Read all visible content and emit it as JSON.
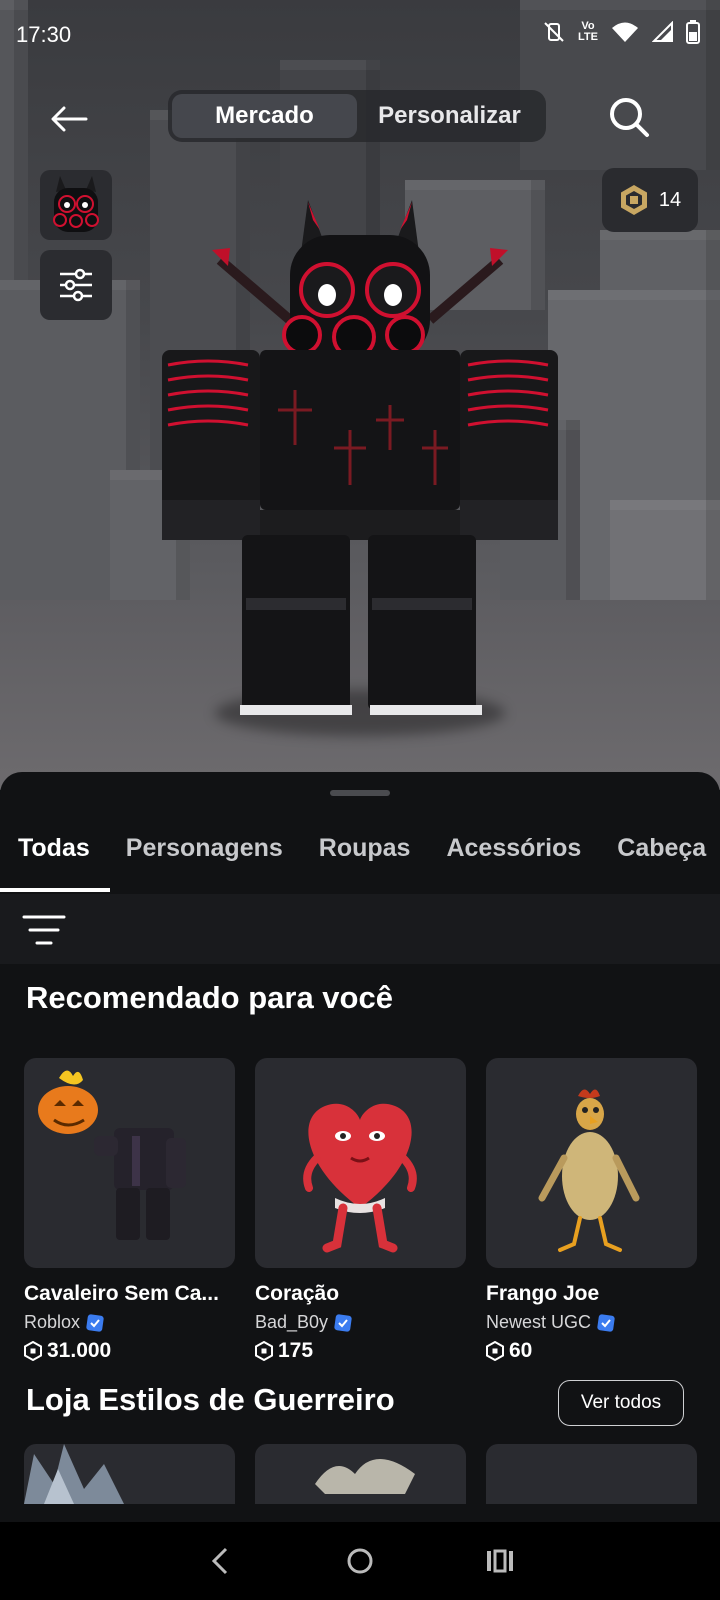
{
  "status_bar": {
    "time": "17:30",
    "network": "LTE",
    "network_top": "Vo"
  },
  "top_nav": {
    "back_icon": "arrow-left-icon",
    "tabs": [
      {
        "label": "Mercado",
        "active": true
      },
      {
        "label": "Personalizar",
        "active": false
      }
    ],
    "search_icon": "search-icon"
  },
  "currency": {
    "icon": "robux-icon",
    "amount": "14"
  },
  "categories": {
    "tabs": [
      "Todas",
      "Personagens",
      "Roupas",
      "Acessórios",
      "Cabeça"
    ],
    "active": "Todas"
  },
  "recommended": {
    "title": "Recomendado para você",
    "items": [
      {
        "name": "Cavaleiro Sem Ca...",
        "creator": "Roblox",
        "verified": true,
        "price": "31.000"
      },
      {
        "name": "Coração",
        "creator": "Bad_B0y",
        "verified": true,
        "price": "175"
      },
      {
        "name": "Frango Joe",
        "creator": "Newest UGC",
        "verified": true,
        "price": "60"
      }
    ]
  },
  "shop": {
    "title": "Loja Estilos de Guerreiro",
    "see_all": "Ver todos"
  },
  "colors": {
    "accent_blue": "#3b7cf0",
    "background": "#111214",
    "card": "#2a2b30"
  }
}
